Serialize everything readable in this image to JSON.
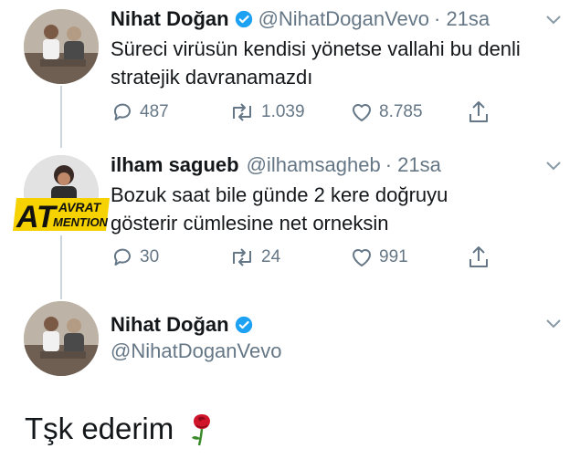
{
  "tweets": [
    {
      "name": "Nihat Doğan",
      "handle": "@NihatDoganVevo",
      "time": "· 21sa",
      "lines": [
        "Süreci virüsün kendisi yönetse vallahi bu denli",
        "stratejik davranamazdı"
      ],
      "replies": "487",
      "retweets": "1.039",
      "likes": "8.785"
    },
    {
      "name": "ilham sagueb",
      "handle": "@ilhamsagheb",
      "time": "· 21sa",
      "lines": [
        "Bozuk saat bile günde 2 kere doğruyu",
        "gösterir cümlesine net orneksin"
      ],
      "replies": "30",
      "retweets": "24",
      "likes": "991",
      "watermark_logo": "AT AVRAT MENTION"
    },
    {
      "name": "Nihat Doğan",
      "handle": "@NihatDoganVevo"
    }
  ],
  "reply_text": "Tşk ederim",
  "colors": {
    "verified": "#1da1f2",
    "icon": "#657786",
    "line": "#ccd6dd",
    "logo": "#f5d200"
  },
  "icons": [
    "verified-badge-icon",
    "reply-icon",
    "retweet-icon",
    "like-icon",
    "share-icon",
    "chevron-down-icon",
    "rose-icon"
  ]
}
